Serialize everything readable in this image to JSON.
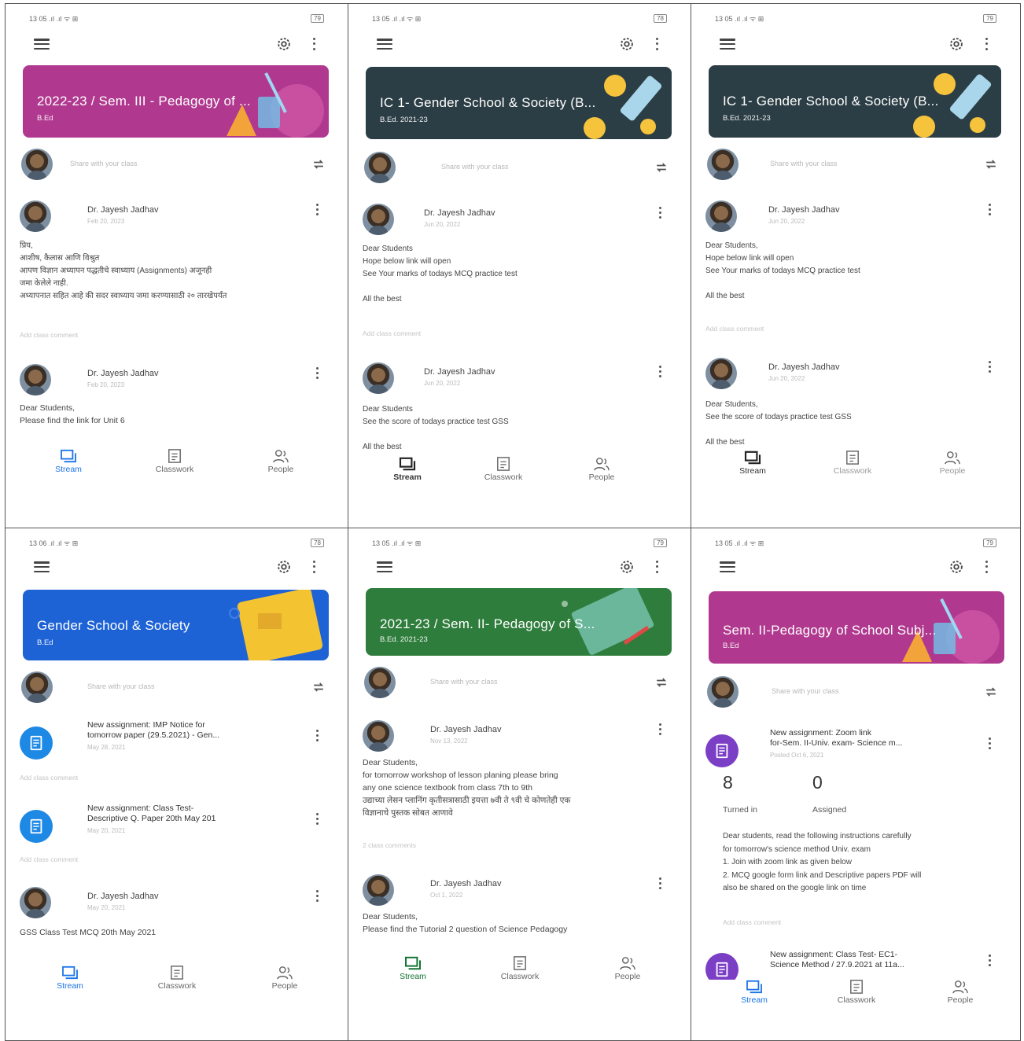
{
  "panels": [
    {
      "status": {
        "time": "13 05 .ıl .ıl ᯤ ⊞",
        "battery": "79"
      },
      "banner": {
        "title": "2022-23 / Sem. III - Pedagogy of ...",
        "subtitle": "B.Ed",
        "color": "#b0398f"
      },
      "share": {
        "placeholder": "Share with your class"
      },
      "posts": [
        {
          "author": "Dr. Jayesh Jadhav",
          "date": "Feb 20, 2023",
          "body": [
            "प्रिय,",
            "आशीष, कैलास आणि विश्रुत",
            "आपण विज्ञान अध्यापन पद्धतीचे स्वाध्याय (Assignments) अजूनही",
            "जमा केलेले नाही.",
            "अध्यापनात सहित आहे की सदर स्वाध्याय जमा करण्यासाठी २० तारखेपर्यंत"
          ],
          "comment": "Add class comment"
        },
        {
          "author": "Dr. Jayesh Jadhav",
          "date": "Feb 20, 2023",
          "body": [
            "Dear Students,",
            "Please find the link for Unit 6"
          ]
        }
      ],
      "nav": {
        "stream": "Stream",
        "classwork": "Classwork",
        "people": "People"
      }
    },
    {
      "status": {
        "time": "13 05 .ıl .ıl ᯤ ⊞",
        "battery": "78"
      },
      "banner": {
        "title": "IC 1- Gender School & Society (B...",
        "subtitle": "B.Ed. 2021-23",
        "color": "#2c3e45"
      },
      "share": {
        "placeholder": "Share with your class"
      },
      "posts": [
        {
          "author": "Dr. Jayesh Jadhav",
          "date": "Jun 20, 2022",
          "body": [
            "Dear Students",
            "Hope below link will open",
            "See Your marks of todays MCQ practice test",
            "",
            "All the best"
          ],
          "comment": "Add class comment"
        },
        {
          "author": "Dr. Jayesh Jadhav",
          "date": "Jun 20, 2022",
          "body": [
            "Dear Students",
            "See the score of todays practice test  GSS",
            "",
            "All the best"
          ]
        }
      ],
      "nav": {
        "stream": "Stream",
        "classwork": "Classwork",
        "people": "People"
      }
    },
    {
      "status": {
        "time": "13 05 .ıl .ıl ᯤ ⊞",
        "battery": "79"
      },
      "banner": {
        "title": "IC 1- Gender School & Society (B...",
        "subtitle": "B.Ed. 2021-23",
        "color": "#2c3e45"
      },
      "share": {
        "placeholder": "Share with your class"
      },
      "posts": [
        {
          "author": "Dr. Jayesh Jadhav",
          "date": "Jun 20, 2022",
          "body": [
            "Dear Students,",
            "Hope below link will open",
            "See Your marks of todays MCQ practice test",
            "",
            "All the best"
          ],
          "comment": "Add class comment"
        },
        {
          "author": "Dr. Jayesh Jadhav",
          "date": "Jun 20, 2022",
          "body": [
            "Dear Students,",
            "See the score of todays practice test  GSS",
            "",
            "All the best"
          ]
        }
      ],
      "nav": {
        "stream": "Stream",
        "classwork": "Classwork",
        "people": "People"
      }
    },
    {
      "status": {
        "time": "13 06 .ıl .ıl ᯤ ⊞",
        "battery": "78"
      },
      "banner": {
        "title": "Gender School & Society",
        "subtitle": "B.Ed",
        "color": "#1e63d6"
      },
      "share": {
        "placeholder": "Share with your class"
      },
      "assignments": [
        {
          "title1": "New assignment: IMP Notice for",
          "title2": "tomorrow paper (29.5.2021) - Gen...",
          "date": "May 28, 2021",
          "comment": "Add class comment"
        },
        {
          "title1": "New assignment: Class Test-",
          "title2": "Descriptive Q. Paper 20th May 201",
          "date": "May 20, 2021",
          "comment": "Add class comment"
        }
      ],
      "posts": [
        {
          "author": "Dr. Jayesh Jadhav",
          "date": "May 20, 2021",
          "body": [
            "GSS Class Test  MCQ  20th May 2021"
          ]
        }
      ],
      "nav": {
        "stream": "Stream",
        "classwork": "Classwork",
        "people": "People"
      }
    },
    {
      "status": {
        "time": "13 05 .ıl .ıl ᯤ ⊞",
        "battery": "79"
      },
      "banner": {
        "title": "2021-23 / Sem. II- Pedagogy of S...",
        "subtitle": "B.Ed. 2021-23",
        "color": "#2f7d3c"
      },
      "share": {
        "placeholder": "Share with your class"
      },
      "posts": [
        {
          "author": "Dr. Jayesh Jadhav",
          "date": "Nov 13, 2022",
          "body": [
            "Dear Students,",
            "for tomorrow workshop of lesson planing please bring",
            "any one science textbook from class 7th to 9th",
            "उद्याच्या लेसन प्लानिंग कृतीसत्रासाठी इयत्ता ७वी ते ९वी चे कोणतेही एक",
            "विज्ञानाचे पुस्तक सोबत आणावे"
          ],
          "comment": "2 class comments"
        },
        {
          "author": "Dr. Jayesh Jadhav",
          "date": "Oct 1, 2022",
          "body": [
            "Dear Students,",
            "Please find the Tutorial  2 question of Science Pedagogy"
          ]
        }
      ],
      "nav": {
        "stream": "Stream",
        "classwork": "Classwork",
        "people": "People"
      }
    },
    {
      "status": {
        "time": "13 05 .ıl .ıl ᯤ ⊞",
        "battery": "79"
      },
      "banner": {
        "title": "Sem. II-Pedagogy of School Subj...",
        "subtitle": "B.Ed",
        "color": "#b0398f"
      },
      "share": {
        "placeholder": "Share with your class"
      },
      "assignments": [
        {
          "title1": "New assignment: Zoom link",
          "title2": "for-Sem. II-Univ. exam- Science m...",
          "date": "Posted Oct 6, 2021"
        },
        {
          "title1": "New assignment: Class Test- EC1-",
          "title2": "Science Method / 27.9.2021 at 11a..."
        }
      ],
      "stats": {
        "turned_in": "8",
        "turned_in_label": "Turned in",
        "assigned": "0",
        "assigned_label": "Assigned"
      },
      "note": [
        "Dear students, read the following instructions carefully",
        "for tomorrow's science method Univ. exam",
        "1. Join with zoom link as given below",
        "2. MCQ google form link and Descriptive papers PDF will",
        "also be shared on the google link on time"
      ],
      "comment": "Add class comment",
      "nav": {
        "stream": "Stream",
        "classwork": "Classwork",
        "people": "People"
      }
    }
  ]
}
